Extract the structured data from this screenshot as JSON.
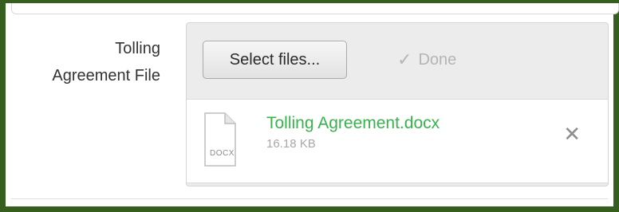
{
  "form": {
    "label_line1": "Tolling",
    "label_line2": "Agreement File"
  },
  "uploader": {
    "select_label": "Select files...",
    "done_label": "Done",
    "done_icon": "check-icon",
    "files": [
      {
        "name": "Tolling Agreement.docx",
        "size": "16.18 KB",
        "icon_ext": "DOCX",
        "remove_icon": "close-icon"
      }
    ]
  },
  "colors": {
    "frame": "#355e1f",
    "file_name": "#37b24d",
    "muted": "#b5b5b5"
  }
}
